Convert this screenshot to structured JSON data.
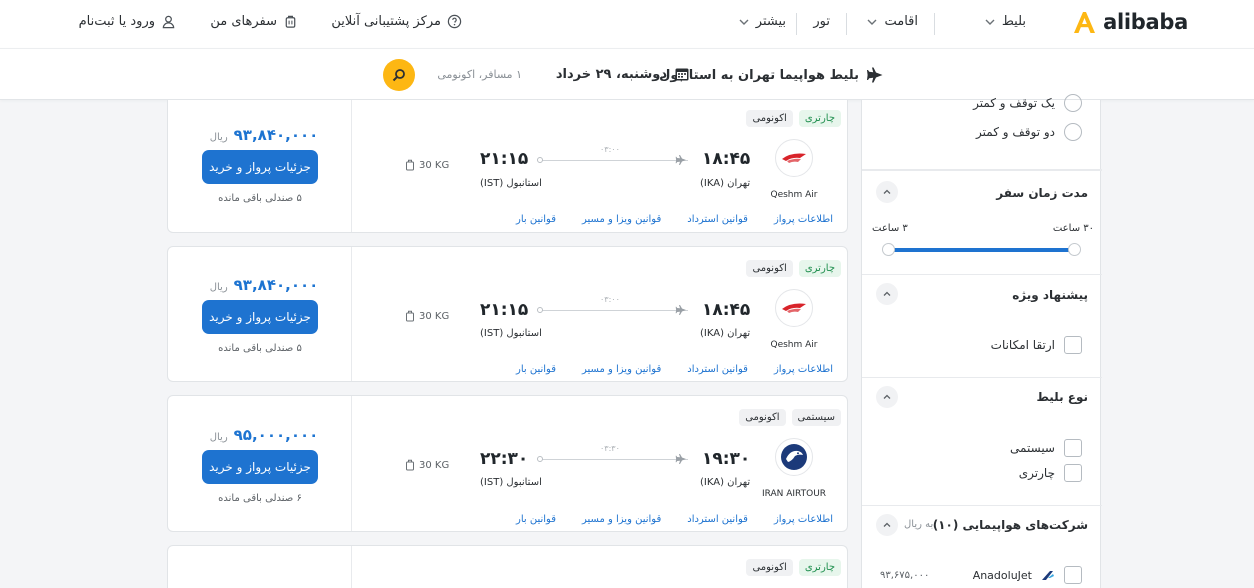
{
  "brand": {
    "name": "alibaba",
    "accent": "#fdb713",
    "primary": "#1e73d0"
  },
  "nav": {
    "ticket": "بلیط",
    "stay": "اقامت",
    "tour": "تور",
    "more": "بیشتر"
  },
  "utility": {
    "support": "مرکز پشتیبانی آنلاین",
    "trips": "سفرهای من",
    "login": "ورود یا ثبت‌نام"
  },
  "summary": {
    "route": "بلیط هواپیما تهران به استانبول",
    "date": "دوشنبه، ۲۹ خرداد",
    "passengers": "۱ مسافر، اکونومی"
  },
  "results": [
    {
      "tags": [
        "چارتری",
        "اکونومی"
      ],
      "airline": "Qeshm Air",
      "dep_time": "۱۸:۴۵",
      "dep_place": "تهران (IKA)",
      "arr_time": "۲۱:۱۵",
      "arr_place": "استانبول (IST)",
      "duration": "۰۳:۰۰",
      "baggage": "30 KG",
      "price": "۹۳,۸۴۰,۰۰۰",
      "currency": "ریال",
      "buy": "جزئیات پرواز و خرید",
      "seats": "۵ صندلی باقی مانده",
      "links": [
        "اطلاعات پرواز",
        "قوانین استرداد",
        "قوانین ویزا و مسیر",
        "قوانین بار"
      ]
    },
    {
      "tags": [
        "چارتری",
        "اکونومی"
      ],
      "airline": "Qeshm Air",
      "dep_time": "۱۸:۴۵",
      "dep_place": "تهران (IKA)",
      "arr_time": "۲۱:۱۵",
      "arr_place": "استانبول (IST)",
      "duration": "۰۳:۰۰",
      "baggage": "30 KG",
      "price": "۹۳,۸۴۰,۰۰۰",
      "currency": "ریال",
      "buy": "جزئیات پرواز و خرید",
      "seats": "۵ صندلی باقی مانده",
      "links": [
        "اطلاعات پرواز",
        "قوانین استرداد",
        "قوانین ویزا و مسیر",
        "قوانین بار"
      ]
    },
    {
      "tags": [
        "سیستمی",
        "اکونومی"
      ],
      "airline": "IRAN AIRTOUR",
      "dep_time": "۱۹:۳۰",
      "dep_place": "تهران (IKA)",
      "arr_time": "۲۲:۳۰",
      "arr_place": "استانبول (IST)",
      "duration": "۰۳:۳۰",
      "baggage": "30 KG",
      "price": "۹۵,۰۰۰,۰۰۰",
      "currency": "ریال",
      "buy": "جزئیات پرواز و خرید",
      "seats": "۶ صندلی باقی مانده",
      "links": [
        "اطلاعات پرواز",
        "قوانین استرداد",
        "قوانین ویزا و مسیر",
        "قوانین بار"
      ]
    },
    {
      "tags": [
        "چارتری",
        "اکونومی"
      ]
    }
  ],
  "filters": {
    "stops": {
      "opt1": "یک توقف و کمتر",
      "opt2": "دو توقف و کمتر"
    },
    "duration": {
      "title": "مدت زمان سفر",
      "max": "۳۰ ساعت",
      "min": "۳ ساعت"
    },
    "special": {
      "title": "پیشنهاد ویژه",
      "opt1": "ارتقا امکانات"
    },
    "ticket_type": {
      "title": "نوع بلیط",
      "opt1": "سیستمی",
      "opt2": "چارتری"
    },
    "airlines": {
      "title": "شرکت‌های هواپیمایی (۱۰)",
      "unit": "به ریال",
      "first_name": "AnadoluJet",
      "first_price": "۹۳,۶۷۵,۰۰۰"
    }
  }
}
